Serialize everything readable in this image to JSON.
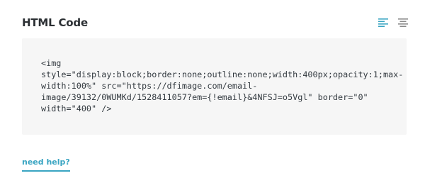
{
  "header": {
    "title": "HTML Code",
    "tools": [
      {
        "name": "align-left",
        "icon": "align-left-icon",
        "active": true,
        "color": "#3aa5c2"
      },
      {
        "name": "align-center",
        "icon": "align-center-icon",
        "active": false,
        "color": "#888888"
      }
    ]
  },
  "code": {
    "lines": [
      "<img",
      "style=\"display:block;border:none;outline:none;width:400px;opacity:1;max-",
      "width:100%\" src=\"https://dfimage.com/email-",
      "image/39132/0WUMKd/1528411057?em={!email}&4NFSJ=o5Vgl\" border=\"0\"",
      "width=\"400\" />"
    ]
  },
  "help": {
    "label": "need help?",
    "color": "#3aa5c2"
  }
}
